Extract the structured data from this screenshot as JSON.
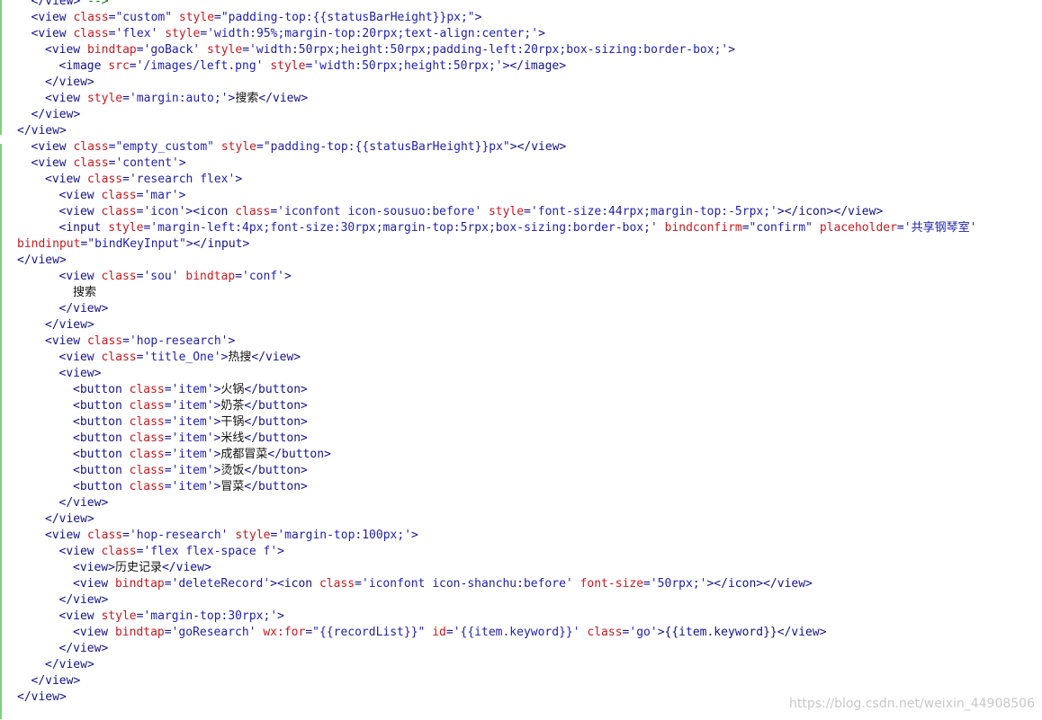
{
  "editor": {
    "lines": [
      {
        "i": 2,
        "t": [
          [
            "tag",
            "</view> "
          ],
          [
            "com",
            "-->"
          ]
        ]
      },
      {
        "i": 2,
        "t": [
          [
            "tag",
            "<view "
          ],
          [
            "attr",
            "class"
          ],
          [
            "tag",
            "="
          ],
          [
            "str",
            "\"custom\""
          ],
          [
            "tag",
            " "
          ],
          [
            "attr",
            "style"
          ],
          [
            "tag",
            "="
          ],
          [
            "str",
            "\"padding-top:{{statusBarHeight}}px;\""
          ],
          [
            "tag",
            ">"
          ]
        ]
      },
      {
        "i": 2,
        "t": [
          [
            "tag",
            "<view "
          ],
          [
            "attr",
            "class"
          ],
          [
            "tag",
            "="
          ],
          [
            "str",
            "'flex'"
          ],
          [
            "tag",
            " "
          ],
          [
            "attr",
            "style"
          ],
          [
            "tag",
            "="
          ],
          [
            "str",
            "'width:95%;margin-top:20rpx;text-align:center;'"
          ],
          [
            "tag",
            ">"
          ]
        ]
      },
      {
        "i": 3,
        "t": [
          [
            "tag",
            "<view "
          ],
          [
            "attr",
            "bindtap"
          ],
          [
            "tag",
            "="
          ],
          [
            "str",
            "'goBack'"
          ],
          [
            "tag",
            " "
          ],
          [
            "attr",
            "style"
          ],
          [
            "tag",
            "="
          ],
          [
            "str",
            "'width:50rpx;height:50rpx;padding-left:20rpx;box-sizing:border-box;'"
          ],
          [
            "tag",
            ">"
          ]
        ]
      },
      {
        "i": 4,
        "t": [
          [
            "tag",
            "<image "
          ],
          [
            "attr",
            "src"
          ],
          [
            "tag",
            "="
          ],
          [
            "str",
            "'/images/left.png'"
          ],
          [
            "tag",
            " "
          ],
          [
            "attr",
            "style"
          ],
          [
            "tag",
            "="
          ],
          [
            "str",
            "'width:50rpx;height:50rpx;'"
          ],
          [
            "tag",
            "></image>"
          ]
        ]
      },
      {
        "i": 3,
        "t": [
          [
            "tag",
            "</view>"
          ]
        ]
      },
      {
        "i": 3,
        "t": [
          [
            "tag",
            "<view "
          ],
          [
            "attr",
            "style"
          ],
          [
            "tag",
            "="
          ],
          [
            "str",
            "'margin:auto;'"
          ],
          [
            "tag",
            ">"
          ],
          [
            "txt",
            "搜索"
          ],
          [
            "tag",
            "</view>"
          ]
        ]
      },
      {
        "i": 2,
        "t": [
          [
            "tag",
            "</view>"
          ]
        ]
      },
      {
        "i": 1,
        "t": [
          [
            "tag",
            "</view>"
          ]
        ]
      },
      {
        "i": 2,
        "t": [
          [
            "tag",
            "<view "
          ],
          [
            "attr",
            "class"
          ],
          [
            "tag",
            "="
          ],
          [
            "str",
            "\"empty_custom\""
          ],
          [
            "tag",
            " "
          ],
          [
            "attr",
            "style"
          ],
          [
            "tag",
            "="
          ],
          [
            "str",
            "\"padding-top:{{statusBarHeight}}px\""
          ],
          [
            "tag",
            "></view>"
          ]
        ]
      },
      {
        "i": 2,
        "t": [
          [
            "tag",
            "<view "
          ],
          [
            "attr",
            "class"
          ],
          [
            "tag",
            "="
          ],
          [
            "str",
            "'content'"
          ],
          [
            "tag",
            ">"
          ]
        ]
      },
      {
        "i": 3,
        "t": [
          [
            "tag",
            "<view "
          ],
          [
            "attr",
            "class"
          ],
          [
            "tag",
            "="
          ],
          [
            "str",
            "'research flex'"
          ],
          [
            "tag",
            ">"
          ]
        ]
      },
      {
        "i": 4,
        "t": [
          [
            "tag",
            "<view "
          ],
          [
            "attr",
            "class"
          ],
          [
            "tag",
            "="
          ],
          [
            "str",
            "'mar'"
          ],
          [
            "tag",
            ">"
          ]
        ]
      },
      {
        "i": 4,
        "t": [
          [
            "tag",
            "<view "
          ],
          [
            "attr",
            "class"
          ],
          [
            "tag",
            "="
          ],
          [
            "str",
            "'icon'"
          ],
          [
            "tag",
            "><icon "
          ],
          [
            "attr",
            "class"
          ],
          [
            "tag",
            "="
          ],
          [
            "str",
            "'iconfont icon-sousuo:before'"
          ],
          [
            "tag",
            " "
          ],
          [
            "attr",
            "style"
          ],
          [
            "tag",
            "="
          ],
          [
            "str",
            "'font-size:44rpx;margin-top:-5rpx;'"
          ],
          [
            "tag",
            "></icon></view>"
          ]
        ]
      },
      {
        "i": 4,
        "t": [
          [
            "tag",
            "<input "
          ],
          [
            "attr",
            "style"
          ],
          [
            "tag",
            "="
          ],
          [
            "str",
            "'margin-left:4px;font-size:30rpx;margin-top:5rpx;box-sizing:border-box;'"
          ],
          [
            "tag",
            " "
          ],
          [
            "attr",
            "bindconfirm"
          ],
          [
            "tag",
            "="
          ],
          [
            "str",
            "\"confirm\""
          ],
          [
            "tag",
            " "
          ],
          [
            "attr",
            "placeholder"
          ],
          [
            "tag",
            "="
          ],
          [
            "str",
            "'共享钢琴室'"
          ]
        ]
      },
      {
        "i": 1,
        "t": [
          [
            "attr",
            "bindinput"
          ],
          [
            "tag",
            "="
          ],
          [
            "str",
            "\"bindKeyInput\""
          ],
          [
            "tag",
            "></input>"
          ]
        ]
      },
      {
        "i": 1,
        "t": [
          [
            "tag",
            "</view>"
          ]
        ]
      },
      {
        "i": 4,
        "t": [
          [
            "tag",
            "<view "
          ],
          [
            "attr",
            "class"
          ],
          [
            "tag",
            "="
          ],
          [
            "str",
            "'sou'"
          ],
          [
            "tag",
            " "
          ],
          [
            "attr",
            "bindtap"
          ],
          [
            "tag",
            "="
          ],
          [
            "str",
            "'conf'"
          ],
          [
            "tag",
            ">"
          ]
        ]
      },
      {
        "i": 5,
        "t": [
          [
            "txt",
            "搜索"
          ]
        ]
      },
      {
        "i": 4,
        "t": [
          [
            "tag",
            "</view>"
          ]
        ]
      },
      {
        "i": 3,
        "t": [
          [
            "tag",
            "</view>"
          ]
        ]
      },
      {
        "i": 3,
        "t": [
          [
            "tag",
            "<view "
          ],
          [
            "attr",
            "class"
          ],
          [
            "tag",
            "="
          ],
          [
            "str",
            "'hop-research'"
          ],
          [
            "tag",
            ">"
          ]
        ]
      },
      {
        "i": 4,
        "t": [
          [
            "tag",
            "<view "
          ],
          [
            "attr",
            "class"
          ],
          [
            "tag",
            "="
          ],
          [
            "str",
            "'title_One'"
          ],
          [
            "tag",
            ">"
          ],
          [
            "txt",
            "热搜"
          ],
          [
            "tag",
            "</view>"
          ]
        ]
      },
      {
        "i": 4,
        "t": [
          [
            "tag",
            "<view>"
          ]
        ]
      },
      {
        "i": 5,
        "t": [
          [
            "tag",
            "<button "
          ],
          [
            "attr",
            "class"
          ],
          [
            "tag",
            "="
          ],
          [
            "str",
            "'item'"
          ],
          [
            "tag",
            ">"
          ],
          [
            "txt",
            "火锅"
          ],
          [
            "tag",
            "</button>"
          ]
        ]
      },
      {
        "i": 5,
        "t": [
          [
            "tag",
            "<button "
          ],
          [
            "attr",
            "class"
          ],
          [
            "tag",
            "="
          ],
          [
            "str",
            "'item'"
          ],
          [
            "tag",
            ">"
          ],
          [
            "txt",
            "奶茶"
          ],
          [
            "tag",
            "</button>"
          ]
        ]
      },
      {
        "i": 5,
        "t": [
          [
            "tag",
            "<button "
          ],
          [
            "attr",
            "class"
          ],
          [
            "tag",
            "="
          ],
          [
            "str",
            "'item'"
          ],
          [
            "tag",
            ">"
          ],
          [
            "txt",
            "干锅"
          ],
          [
            "tag",
            "</button>"
          ]
        ]
      },
      {
        "i": 5,
        "t": [
          [
            "tag",
            "<button "
          ],
          [
            "attr",
            "class"
          ],
          [
            "tag",
            "="
          ],
          [
            "str",
            "'item'"
          ],
          [
            "tag",
            ">"
          ],
          [
            "txt",
            "米线"
          ],
          [
            "tag",
            "</button>"
          ]
        ]
      },
      {
        "i": 5,
        "t": [
          [
            "tag",
            "<button "
          ],
          [
            "attr",
            "class"
          ],
          [
            "tag",
            "="
          ],
          [
            "str",
            "'item'"
          ],
          [
            "tag",
            ">"
          ],
          [
            "txt",
            "成都冒菜"
          ],
          [
            "tag",
            "</button>"
          ]
        ]
      },
      {
        "i": 5,
        "t": [
          [
            "tag",
            "<button "
          ],
          [
            "attr",
            "class"
          ],
          [
            "tag",
            "="
          ],
          [
            "str",
            "'item'"
          ],
          [
            "tag",
            ">"
          ],
          [
            "txt",
            "烫饭"
          ],
          [
            "tag",
            "</button>"
          ]
        ]
      },
      {
        "i": 5,
        "t": [
          [
            "tag",
            "<button "
          ],
          [
            "attr",
            "class"
          ],
          [
            "tag",
            "="
          ],
          [
            "str",
            "'item'"
          ],
          [
            "tag",
            ">"
          ],
          [
            "txt",
            "冒菜"
          ],
          [
            "tag",
            "</button>"
          ]
        ]
      },
      {
        "i": 4,
        "t": [
          [
            "tag",
            "</view>"
          ]
        ]
      },
      {
        "i": 3,
        "t": [
          [
            "tag",
            "</view>"
          ]
        ]
      },
      {
        "i": 3,
        "t": [
          [
            "tag",
            "<view "
          ],
          [
            "attr",
            "class"
          ],
          [
            "tag",
            "="
          ],
          [
            "str",
            "'hop-research'"
          ],
          [
            "tag",
            " "
          ],
          [
            "attr",
            "style"
          ],
          [
            "tag",
            "="
          ],
          [
            "str",
            "'margin-top:100px;'"
          ],
          [
            "tag",
            ">"
          ]
        ]
      },
      {
        "i": 4,
        "t": [
          [
            "tag",
            "<view "
          ],
          [
            "attr",
            "class"
          ],
          [
            "tag",
            "="
          ],
          [
            "str",
            "'flex flex-space f'"
          ],
          [
            "tag",
            ">"
          ]
        ]
      },
      {
        "i": 5,
        "t": [
          [
            "tag",
            "<view>"
          ],
          [
            "txt",
            "历史记录"
          ],
          [
            "tag",
            "</view>"
          ]
        ]
      },
      {
        "i": 5,
        "t": [
          [
            "tag",
            "<view "
          ],
          [
            "attr",
            "bindtap"
          ],
          [
            "tag",
            "="
          ],
          [
            "str",
            "'deleteRecord'"
          ],
          [
            "tag",
            "><icon "
          ],
          [
            "attr",
            "class"
          ],
          [
            "tag",
            "="
          ],
          [
            "str",
            "'iconfont icon-shanchu:before'"
          ],
          [
            "tag",
            " "
          ],
          [
            "attr",
            "font-size"
          ],
          [
            "tag",
            "="
          ],
          [
            "str",
            "'50rpx;'"
          ],
          [
            "tag",
            "></icon></view>"
          ]
        ]
      },
      {
        "i": 4,
        "t": [
          [
            "tag",
            "</view>"
          ]
        ]
      },
      {
        "i": 4,
        "t": [
          [
            "tag",
            "<view "
          ],
          [
            "attr",
            "style"
          ],
          [
            "tag",
            "="
          ],
          [
            "str",
            "'margin-top:30rpx;'"
          ],
          [
            "tag",
            ">"
          ]
        ]
      },
      {
        "i": 5,
        "t": [
          [
            "tag",
            "<view "
          ],
          [
            "attr",
            "bindtap"
          ],
          [
            "tag",
            "="
          ],
          [
            "str",
            "'goResearch'"
          ],
          [
            "tag",
            " "
          ],
          [
            "attr",
            "wx:for"
          ],
          [
            "tag",
            "="
          ],
          [
            "str",
            "\"{{recordList}}\""
          ],
          [
            "tag",
            " "
          ],
          [
            "attr",
            "id"
          ],
          [
            "tag",
            "="
          ],
          [
            "str",
            "'{{item.keyword}}'"
          ],
          [
            "tag",
            " "
          ],
          [
            "attr",
            "class"
          ],
          [
            "tag",
            "="
          ],
          [
            "str",
            "'go'"
          ],
          [
            "tag",
            ">{{item.keyword}}</view>"
          ]
        ]
      },
      {
        "i": 4,
        "t": [
          [
            "tag",
            "</view>"
          ]
        ]
      },
      {
        "i": 3,
        "t": [
          [
            "tag",
            "</view>"
          ]
        ]
      },
      {
        "i": 2,
        "t": [
          [
            "tag",
            "</view>"
          ]
        ]
      },
      {
        "i": 1,
        "t": [
          [
            "tag",
            "</view>"
          ]
        ]
      }
    ]
  },
  "watermark": "https://blog.csdn.net/weixin_44908506",
  "colors": {
    "tag": "#13138c",
    "attr": "#c8191f",
    "string": "#1f1fb0",
    "text": "#111111",
    "comment": "#0a7a0a",
    "gutter_change": "#7fd07f"
  }
}
